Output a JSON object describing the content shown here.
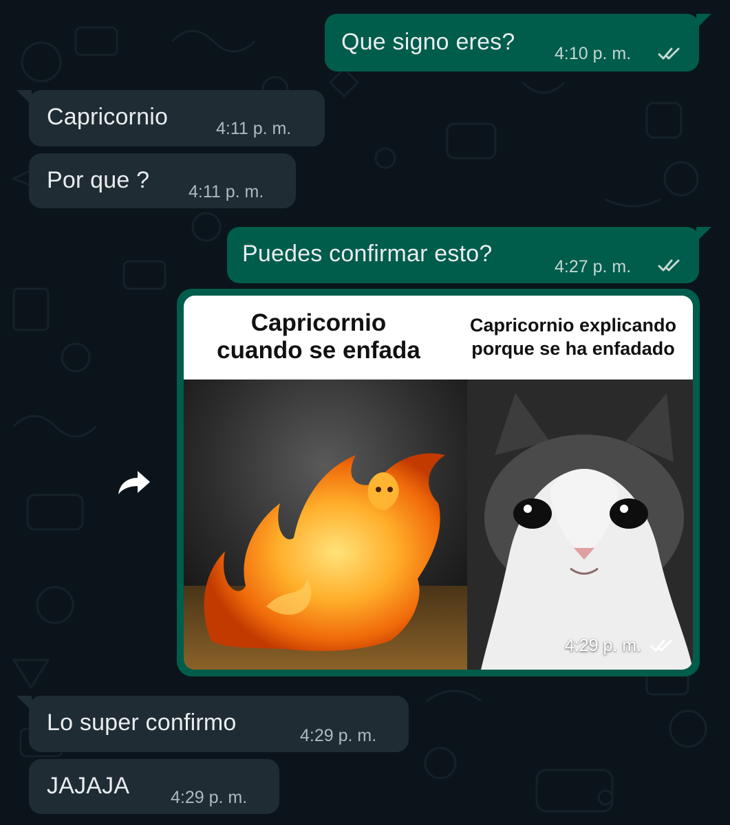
{
  "colors": {
    "background": "#0b141a",
    "outgoing_bubble": "#005c4b",
    "incoming_bubble": "#202c33",
    "text": "#e9edef",
    "timestamp": "#aebac1",
    "read_ticks": "#53bdeb"
  },
  "messages": [
    {
      "direction": "outgoing",
      "text": "Que signo eres?",
      "time": "4:10 p. m.",
      "status_icon": "double-check-icon"
    },
    {
      "direction": "incoming",
      "text": "Capricornio",
      "time": "4:11 p. m."
    },
    {
      "direction": "incoming",
      "text": "Por que ?",
      "time": "4:11 p. m."
    },
    {
      "direction": "outgoing",
      "text": "Puedes confirmar esto?",
      "time": "4:27 p. m.",
      "status_icon": "double-check-icon"
    },
    {
      "direction": "outgoing",
      "type": "image",
      "time": "4:29 p. m.",
      "status_icon": "double-check-icon",
      "image": {
        "left_caption": "Capricornio cuando se enfada",
        "left_caption_lines": [
          "Capricornio",
          "cuando se enfada"
        ],
        "right_caption": "Capricornio explicando porque se ha enfadado",
        "right_caption_lines": [
          "Capricornio explicando",
          "porque se ha enfadado"
        ],
        "left_panel": "cat-on-fire-image",
        "right_panel": "crying-cat-image"
      },
      "action_icon": "forward-icon"
    },
    {
      "direction": "incoming",
      "text": "Lo super confirmo",
      "time": "4:29 p. m."
    },
    {
      "direction": "incoming",
      "text": "JAJAJA",
      "time": "4:29 p. m."
    }
  ]
}
